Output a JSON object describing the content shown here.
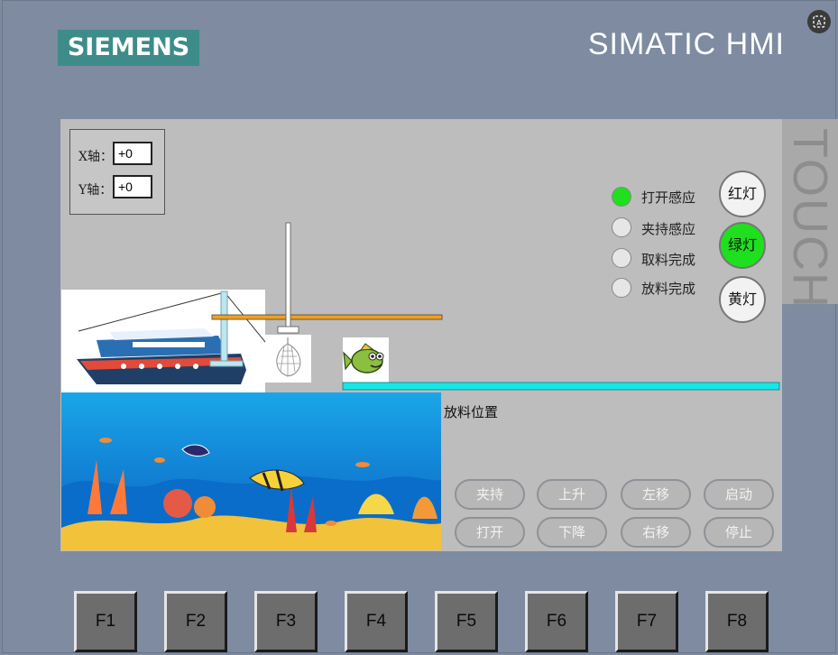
{
  "header": {
    "logo_text": "SIEMENS",
    "product_name": "SIMATIC HMI",
    "corner_icon": "text-recognition-icon",
    "touch_text": "TOUCH"
  },
  "axes": {
    "x_label": "X轴：",
    "x_value": "+0",
    "y_label": "Y轴：",
    "y_value": "+0"
  },
  "indicators": [
    {
      "label": "打开感应",
      "color": "#1ee01e"
    },
    {
      "label": "夹持感应",
      "color": "#e6e6e6"
    },
    {
      "label": "取料完成",
      "color": "#e6e6e6"
    },
    {
      "label": "放料完成",
      "color": "#e6e6e6"
    }
  ],
  "lights": {
    "red": "红灯",
    "green": "绿灯",
    "yellow": "黄灯",
    "green_color": "#1ee01e"
  },
  "scene": {
    "drop_label": "放料位置",
    "conveyor_color": "#17e6e8",
    "arm_color": "#f0a020"
  },
  "buttons": {
    "clamp": "夹持",
    "up": "上升",
    "left": "左移",
    "start": "启动",
    "open": "打开",
    "down": "下降",
    "right": "右移",
    "stop": "停止"
  },
  "fkeys": [
    "F1",
    "F2",
    "F3",
    "F4",
    "F5",
    "F6",
    "F7",
    "F8"
  ]
}
